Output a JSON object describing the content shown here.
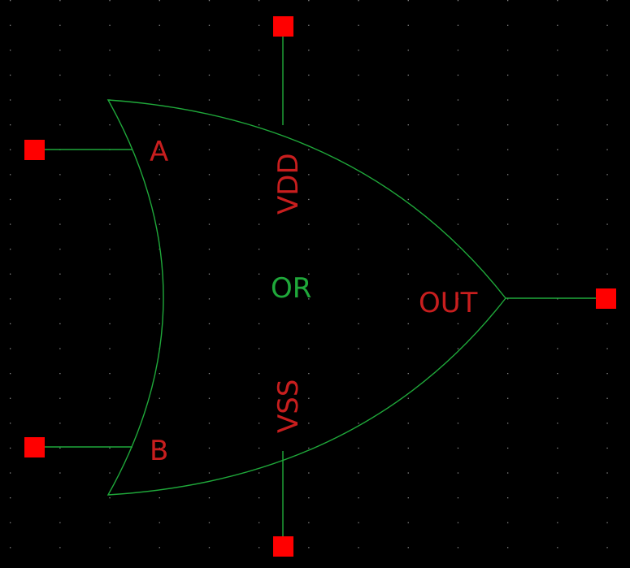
{
  "symbol": {
    "cell_label": "OR",
    "pins": {
      "input_a": "A",
      "input_b": "B",
      "output": "OUT",
      "supply": "VDD",
      "ground": "VSS"
    }
  },
  "colors": {
    "background": "#000000",
    "body_outline": "#1fa83a",
    "cell_label": "#1fa83a",
    "pin_label": "#c81e1e",
    "pin_square": "#ff0000",
    "wire": "#1fa83a",
    "grid_dot": "#8a8a8a"
  }
}
